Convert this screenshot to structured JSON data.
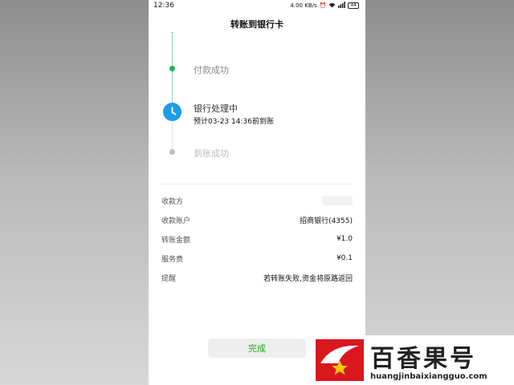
{
  "statusbar": {
    "time": "12:36",
    "network": "4.00 KB/s",
    "battery": "44"
  },
  "navbar": {
    "title": "转账到银行卡"
  },
  "timeline": {
    "step1": "付款成功",
    "step2": "银行处理中",
    "step2_sub": "预计03-23 14:36前到账",
    "step3": "到账成功"
  },
  "details": {
    "payee_label": "收款方",
    "account_label": "收款账户",
    "account_value": "招商银行(4355)",
    "amount_label": "转账金额",
    "amount_value": "¥1.0",
    "fee_label": "服务费",
    "fee_value": "¥0.1",
    "reminder_label": "提醒",
    "reminder_value": "若转账失败,资金将原路返回"
  },
  "done_button": "完成",
  "watermark": {
    "title": "百香果号",
    "url": "huangjinbaixiangguo.com"
  },
  "colors": {
    "accent_green": "#1aad19",
    "clock_blue": "#1e9de6",
    "brand_red": "#d9171f"
  }
}
